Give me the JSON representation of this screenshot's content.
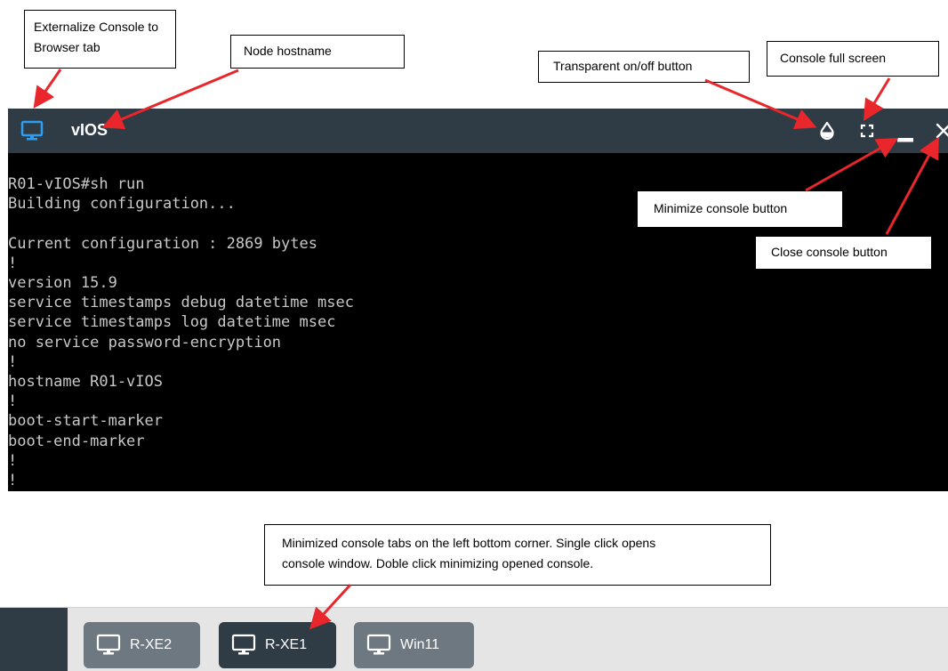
{
  "annotations": {
    "externalize": [
      "Externalize Console to",
      "Browser tab"
    ],
    "hostname": "Node hostname",
    "transparent": "Transparent on/off button",
    "fullscreen": "Console full screen",
    "minimize": "Minimize console button",
    "close": "Close console button",
    "tabs_note": [
      "Minimized console tabs on the left bottom corner. Single click opens",
      "console window. Doble click minimizing opened console."
    ]
  },
  "console": {
    "hostname": "vIOS",
    "output": "R01-vIOS#sh run\nBuilding configuration...\n\nCurrent configuration : 2869 bytes\n!\nversion 15.9\nservice timestamps debug datetime msec\nservice timestamps log datetime msec\nno service password-encryption\n!\nhostname R01-vIOS\n!\nboot-start-marker\nboot-end-marker\n!\n!"
  },
  "taskbar": {
    "tabs": [
      {
        "label": "R-XE2",
        "active": false
      },
      {
        "label": "R-XE1",
        "active": true
      },
      {
        "label": "Win11",
        "active": false
      }
    ]
  },
  "colors": {
    "titlebar": "#2f3b45",
    "monitor_icon": "#2a9df4",
    "arrow": "#e8262b",
    "tab_inactive": "#6e7880",
    "tab_active": "#2f3b45"
  },
  "icons": [
    "monitor-icon",
    "droplet-icon",
    "fullscreen-icon",
    "minimize-icon",
    "close-icon"
  ]
}
